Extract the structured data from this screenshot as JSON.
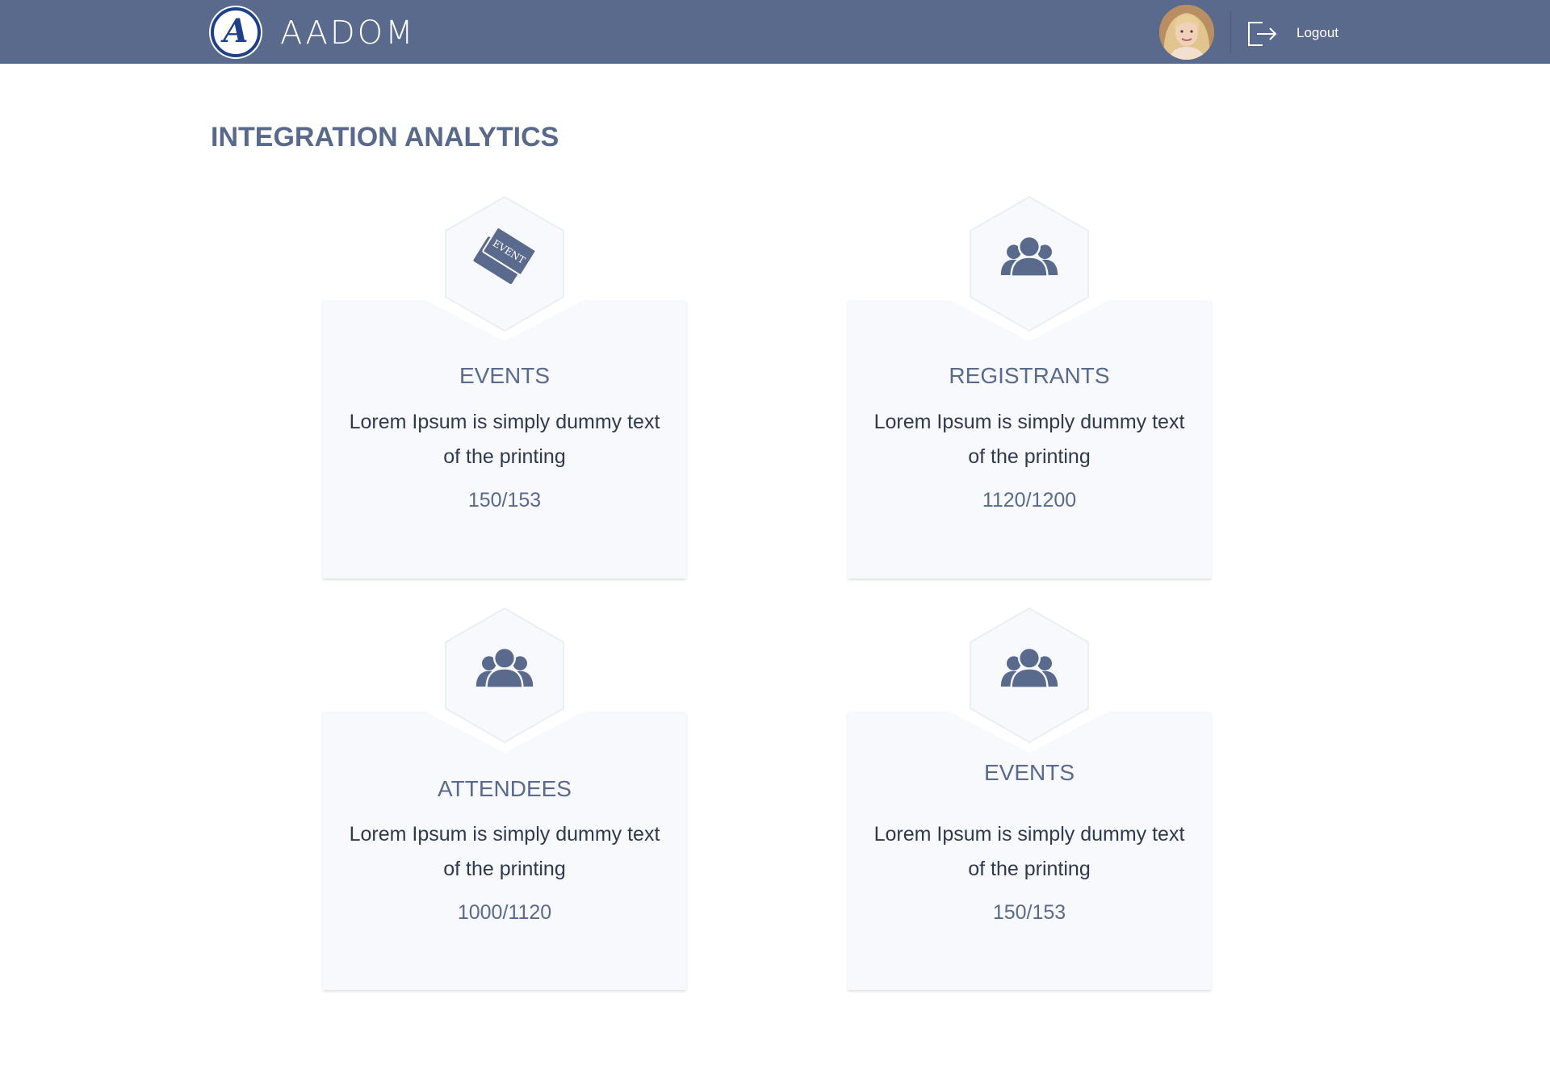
{
  "header": {
    "logo_letter": "A",
    "brand": "AADOM",
    "logout_label": "Logout",
    "bg_color": "#5a6a8c"
  },
  "page": {
    "title": "INTEGRATION ANALYTICS"
  },
  "cards": [
    {
      "icon": "event-ticket-icon",
      "title": "EVENTS",
      "description": "Lorem Ipsum is simply dummy text of the printing",
      "stat": "150/153",
      "ticket_text": "EVENT"
    },
    {
      "icon": "users-group-icon",
      "title": "REGISTRANTS",
      "description": "Lorem Ipsum is simply dummy text of the printing",
      "stat": "1120/1200"
    },
    {
      "icon": "users-group-icon",
      "title": "ATTENDEES",
      "description": "Lorem Ipsum is simply dummy text of the printing",
      "stat": "1000/1120"
    },
    {
      "icon": "users-group-icon",
      "title": "EVENTS",
      "description": "Lorem Ipsum is simply dummy text of the printing",
      "stat": "150/153"
    }
  ]
}
